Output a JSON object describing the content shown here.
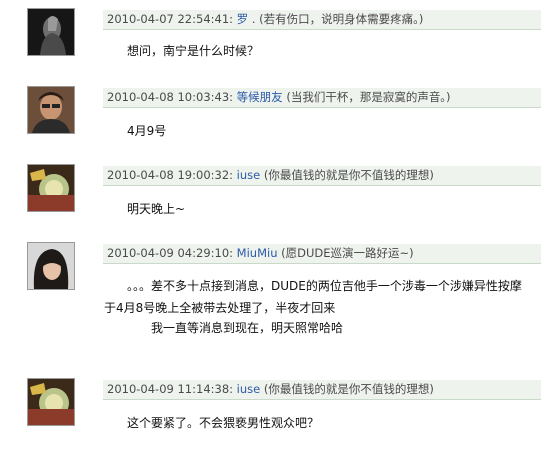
{
  "comments": [
    {
      "timestamp": "2010-04-07 22:54:41:",
      "username": "罗",
      "signature": " . (若有伤口，说明身体需要疼痛。)",
      "lines": [
        "想问，南宁是什么时候？"
      ]
    },
    {
      "timestamp": "2010-04-08 10:03:43:",
      "username": "等候朋友",
      "signature": " (当我们干杯，那是寂寞的声音。)",
      "lines": [
        "4月9号"
      ]
    },
    {
      "timestamp": "2010-04-08 19:00:32:",
      "username": "iuse",
      "signature": " (你最值钱的就是你不值钱的理想)",
      "lines": [
        "明天晚上~"
      ]
    },
    {
      "timestamp": "2010-04-09 04:29:10:",
      "username": "MiuMiu",
      "signature": " (愿DUDE巡演一路好运~)",
      "lines": [
        "。。。差不多十点接到消息，DUDE的两位吉他手一个涉毒一个涉嫌异性按摩",
        "于4月8号晚上全被带去处理了，半夜才回来",
        "我一直等消息到现在，明天照常哈哈"
      ]
    },
    {
      "timestamp": "2010-04-09 11:14:38:",
      "username": "iuse",
      "signature": " (你最值钱的就是你不值钱的理想)",
      "lines": [
        "这个要紧了。不会猥亵男性观众吧？"
      ]
    }
  ]
}
